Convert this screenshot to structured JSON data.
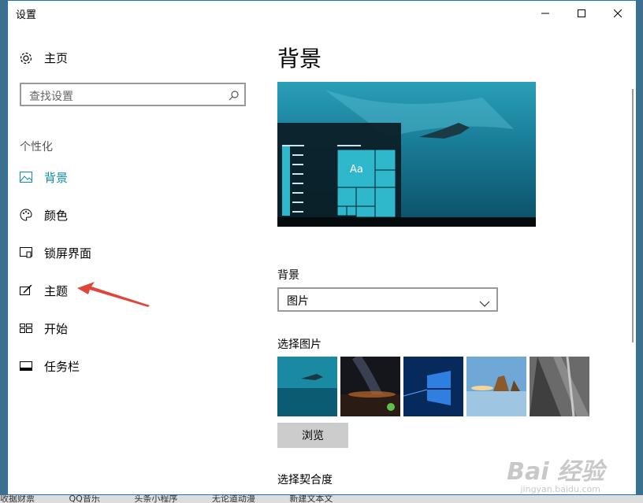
{
  "window": {
    "title": "设置"
  },
  "sidebar": {
    "home_label": "主页",
    "search_placeholder": "查找设置",
    "section_label": "个性化",
    "items": [
      {
        "label": "背景",
        "icon": "picture-icon",
        "active": true
      },
      {
        "label": "颜色",
        "icon": "palette-icon",
        "active": false
      },
      {
        "label": "锁屏界面",
        "icon": "lockscreen-icon",
        "active": false
      },
      {
        "label": "主题",
        "icon": "theme-icon",
        "active": false
      },
      {
        "label": "开始",
        "icon": "start-icon",
        "active": false
      },
      {
        "label": "任务栏",
        "icon": "taskbar-icon",
        "active": false
      }
    ]
  },
  "main": {
    "title": "背景",
    "preview_tile_text": "Aa",
    "background_label": "背景",
    "background_value": "图片",
    "choose_picture_label": "选择图片",
    "browse_label": "浏览",
    "fit_label": "选择契合度"
  },
  "watermark": {
    "text": "Bai 经验",
    "sub": "jingyan.baidu.com"
  },
  "taskbar_strip": [
    "收据财票",
    "QQ音乐",
    "头条小程序",
    "无论道动漫",
    "新建文本文"
  ],
  "colors": {
    "accent": "#0e8ea8",
    "window_border": "#1a73b5"
  }
}
